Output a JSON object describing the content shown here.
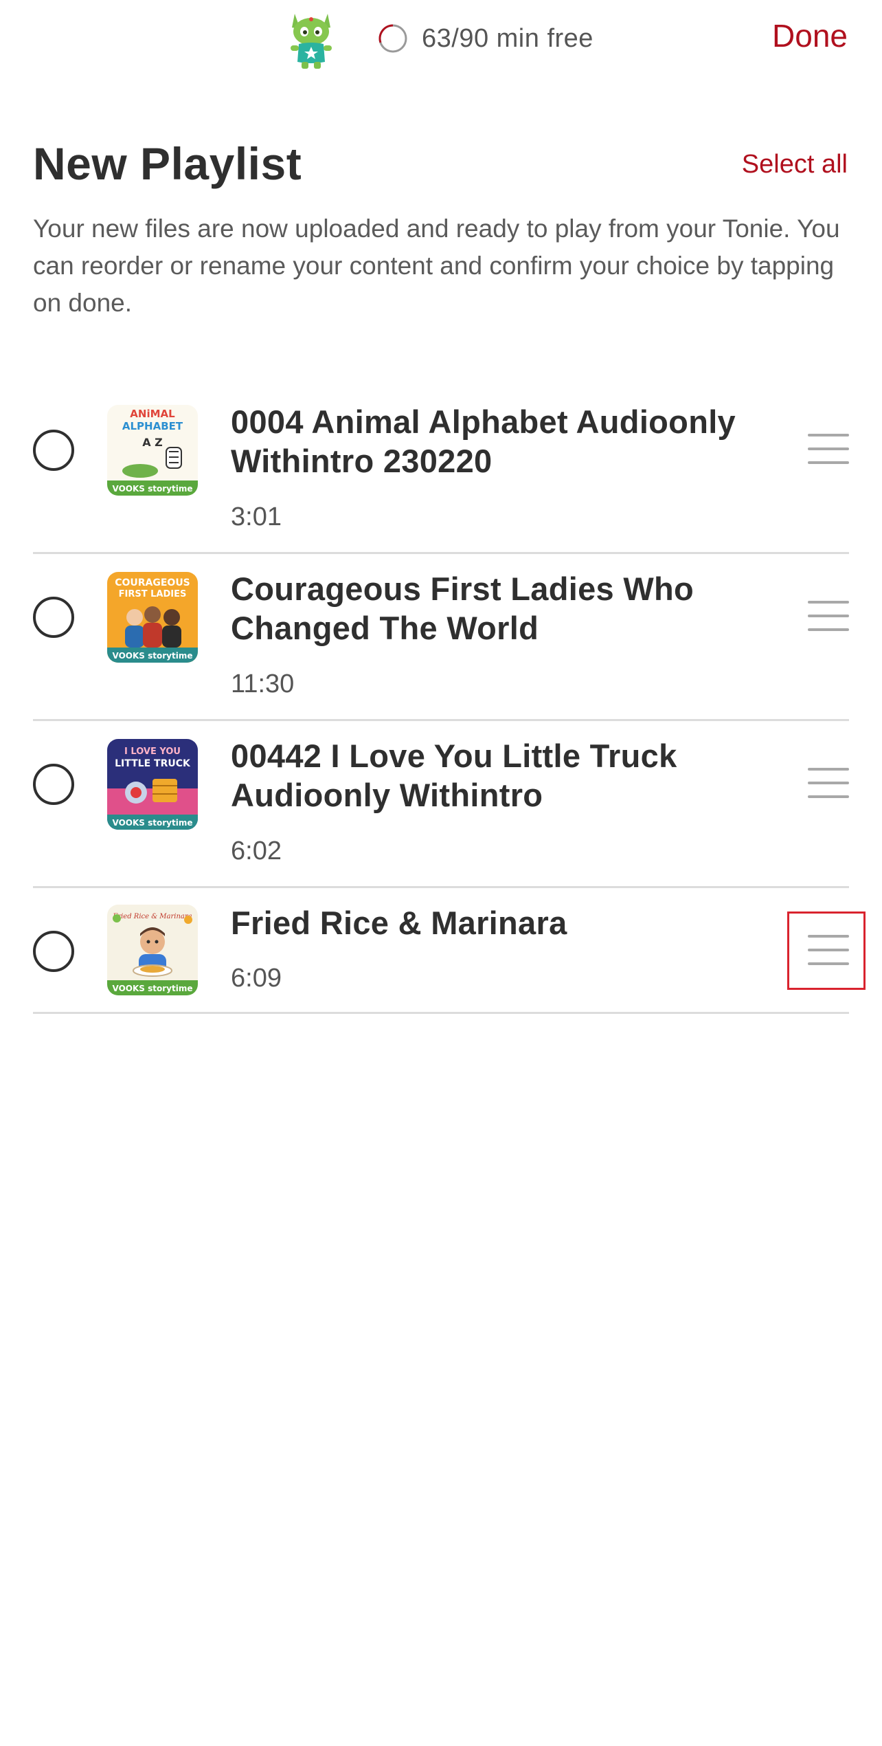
{
  "header": {
    "capacity_text": "63/90 min free",
    "capacity_fraction_free": 0.7,
    "done_label": "Done"
  },
  "playlist": {
    "title": "New Playlist",
    "select_all_label": "Select all",
    "description": "Your new files are now uploaded and ready to play from your Tonie. You can reorder or rename your content and confirm your choice by tapping on done."
  },
  "tracks": [
    {
      "title": "0004 Animal Alphabet Audioonly Withintro 230220",
      "duration": "3:01",
      "cover_top": "ANiMAL",
      "cover_mid": "ALPHABET",
      "cover_small": "A Z",
      "cover_brand": "VOOKS storytime"
    },
    {
      "title": "Courageous First Ladies Who Changed The World",
      "duration": "11:30",
      "cover_top": "COURAGEOUS",
      "cover_mid": "FIRST LADIES",
      "cover_brand": "VOOKS storytime"
    },
    {
      "title": "00442 I Love You Little Truck Audioonly Withintro",
      "duration": "6:02",
      "cover_top": "I LOVE YOU",
      "cover_mid": "LITTLE TRUCK",
      "cover_brand": "VOOKS storytime"
    },
    {
      "title": "Fried Rice & Marinara",
      "duration": "6:09",
      "cover_top": "Fried Rice & Marinara",
      "cover_brand": "VOOKS storytime"
    }
  ],
  "colors": {
    "accent": "#b0101e",
    "text": "#2f2f2f",
    "muted": "#555555",
    "divider": "#dcdcdc",
    "highlight": "#d9232e"
  }
}
